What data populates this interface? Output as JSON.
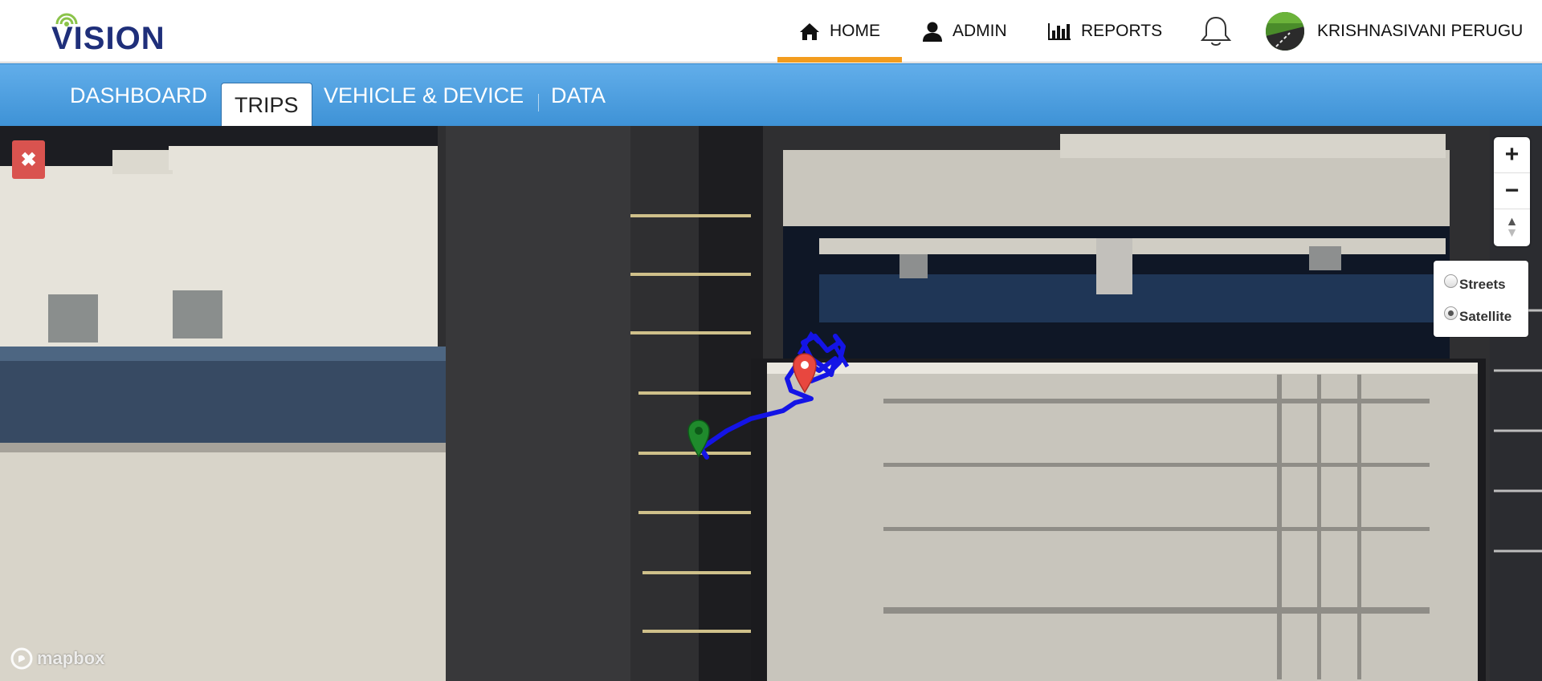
{
  "app": {
    "logo_text": "VISION"
  },
  "topnav": {
    "home_label": "HOME",
    "admin_label": "ADMIN",
    "reports_label": "REPORTS",
    "user_name": "KRISHNASIVANI PERUGU",
    "active_color": "#f39c1e"
  },
  "subnav": {
    "tabs": [
      {
        "label": "DASHBOARD"
      },
      {
        "label": "TRIPS"
      },
      {
        "label": "VEHICLE & DEVICE"
      },
      {
        "label": "DATA"
      }
    ],
    "active_tab": "TRIPS"
  },
  "map": {
    "close_symbol": "✖",
    "zoom_in": "+",
    "zoom_out": "−",
    "compass": "▲",
    "layers": [
      {
        "label": "Streets",
        "selected": false
      },
      {
        "label": "Satellite",
        "selected": true
      }
    ],
    "attribution": "mapbox",
    "start_marker_color": "#1f8a2c",
    "end_marker_color": "#e8473f",
    "route_color": "#1414e6"
  },
  "icons": [
    "home-icon",
    "user-icon",
    "bar-chart-icon",
    "bell-icon",
    "close-icon",
    "mapbox-logo-icon"
  ]
}
